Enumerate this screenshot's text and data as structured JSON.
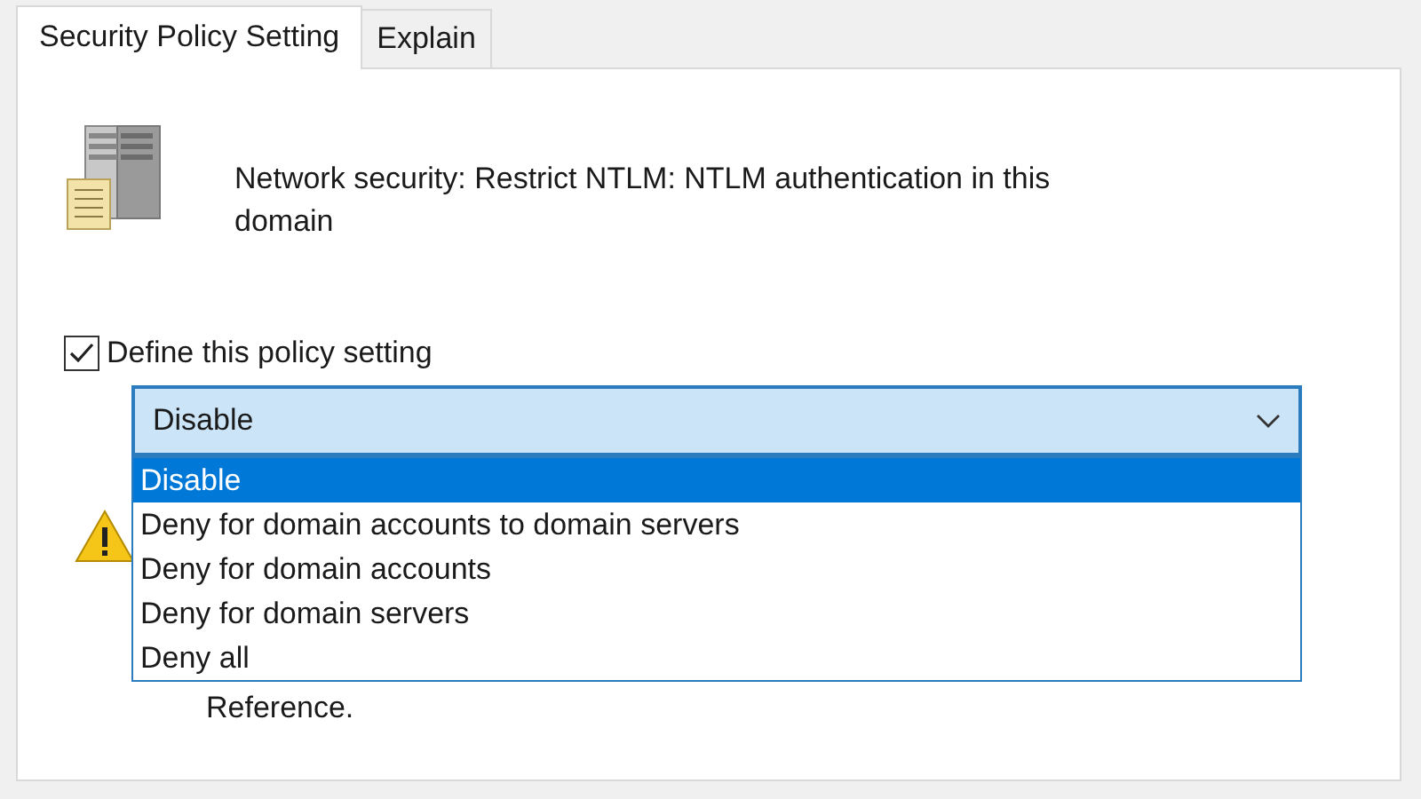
{
  "tabs": [
    {
      "label": "Security Policy Setting",
      "selected": true
    },
    {
      "label": "Explain",
      "selected": false
    }
  ],
  "policy": {
    "description": "Network security: Restrict NTLM: NTLM authentication in this domain"
  },
  "define_setting": {
    "label": "Define this policy setting",
    "checked": true
  },
  "dropdown": {
    "value": "Disable",
    "expanded": true,
    "options": [
      {
        "label": "Disable",
        "selected": true
      },
      {
        "label": "Deny for domain accounts to domain servers",
        "selected": false
      },
      {
        "label": "Deny for domain accounts",
        "selected": false
      },
      {
        "label": "Deny for domain servers",
        "selected": false
      },
      {
        "label": "Deny all",
        "selected": false
      }
    ]
  },
  "warning": {
    "text": "Reference."
  }
}
